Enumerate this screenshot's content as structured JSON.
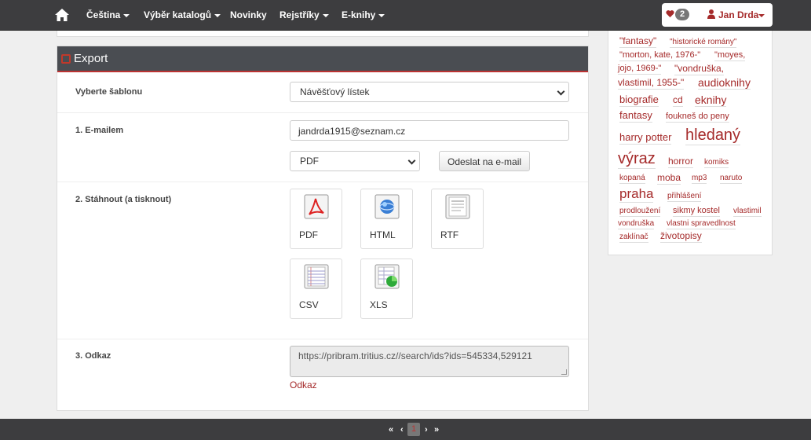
{
  "navbar": {
    "items": [
      {
        "label": "Čeština",
        "dropdown": true
      },
      {
        "label": "Výběr katalogů",
        "dropdown": true
      },
      {
        "label": "Novinky",
        "dropdown": false
      },
      {
        "label": "Rejstříky",
        "dropdown": true
      },
      {
        "label": "E-knihy",
        "dropdown": true
      }
    ],
    "favorites_count": "2",
    "user_name": "Jan Drda"
  },
  "export": {
    "title": "Export",
    "template_label": "Vyberte šablonu",
    "template_value": "Návěšťový lístek",
    "email_label": "1. E-mailem",
    "email_value": "jandrda1915@seznam.cz",
    "format_value": "PDF",
    "send_button": "Odeslat na e-mail",
    "download_label": "2. Stáhnout (a tisknout)",
    "formats": [
      {
        "label": "PDF",
        "icon": "pdf-icon"
      },
      {
        "label": "HTML",
        "icon": "html-icon"
      },
      {
        "label": "RTF",
        "icon": "rtf-icon"
      },
      {
        "label": "CSV",
        "icon": "csv-icon"
      },
      {
        "label": "XLS",
        "icon": "xls-icon"
      }
    ],
    "link_label": "3. Odkaz",
    "link_value": "https://pribram.tritius.cz//search/ids?ids=545334,529121",
    "link_text": "Odkaz"
  },
  "tag_cloud": [
    {
      "text": "\"fantasy\""
    },
    {
      "text": "\"historické romány\""
    },
    {
      "text": "\"morton, kate, 1976-\""
    },
    {
      "text": "\"moyes,"
    },
    {
      "text": "jojo, 1969-\""
    },
    {
      "text": "\"vondruška,"
    },
    {
      "text": "vlastimil, 1955-\""
    },
    {
      "text": "audioknihy"
    },
    {
      "text": "biografie"
    },
    {
      "text": "cd"
    },
    {
      "text": "eknihy"
    },
    {
      "text": "fantasy"
    },
    {
      "text": "foukneš do peny"
    },
    {
      "text": "harry potter"
    },
    {
      "text": "hledaný"
    },
    {
      "text": "výraz"
    },
    {
      "text": "horror"
    },
    {
      "text": "komiks"
    },
    {
      "text": "kopaná"
    },
    {
      "text": "moba"
    },
    {
      "text": "mp3"
    },
    {
      "text": "naruto"
    },
    {
      "text": "praha"
    },
    {
      "text": "přihlášení"
    },
    {
      "text": "prodloužení"
    },
    {
      "text": "sikmy kostel"
    },
    {
      "text": "vlastimil"
    },
    {
      "text": "vondruška"
    },
    {
      "text": "vlastni spravedlnost"
    },
    {
      "text": "zaklínač"
    },
    {
      "text": "životopisy"
    }
  ],
  "pagination": {
    "first": "«",
    "prev": "‹",
    "current": "1",
    "next": "›",
    "last": "»"
  }
}
